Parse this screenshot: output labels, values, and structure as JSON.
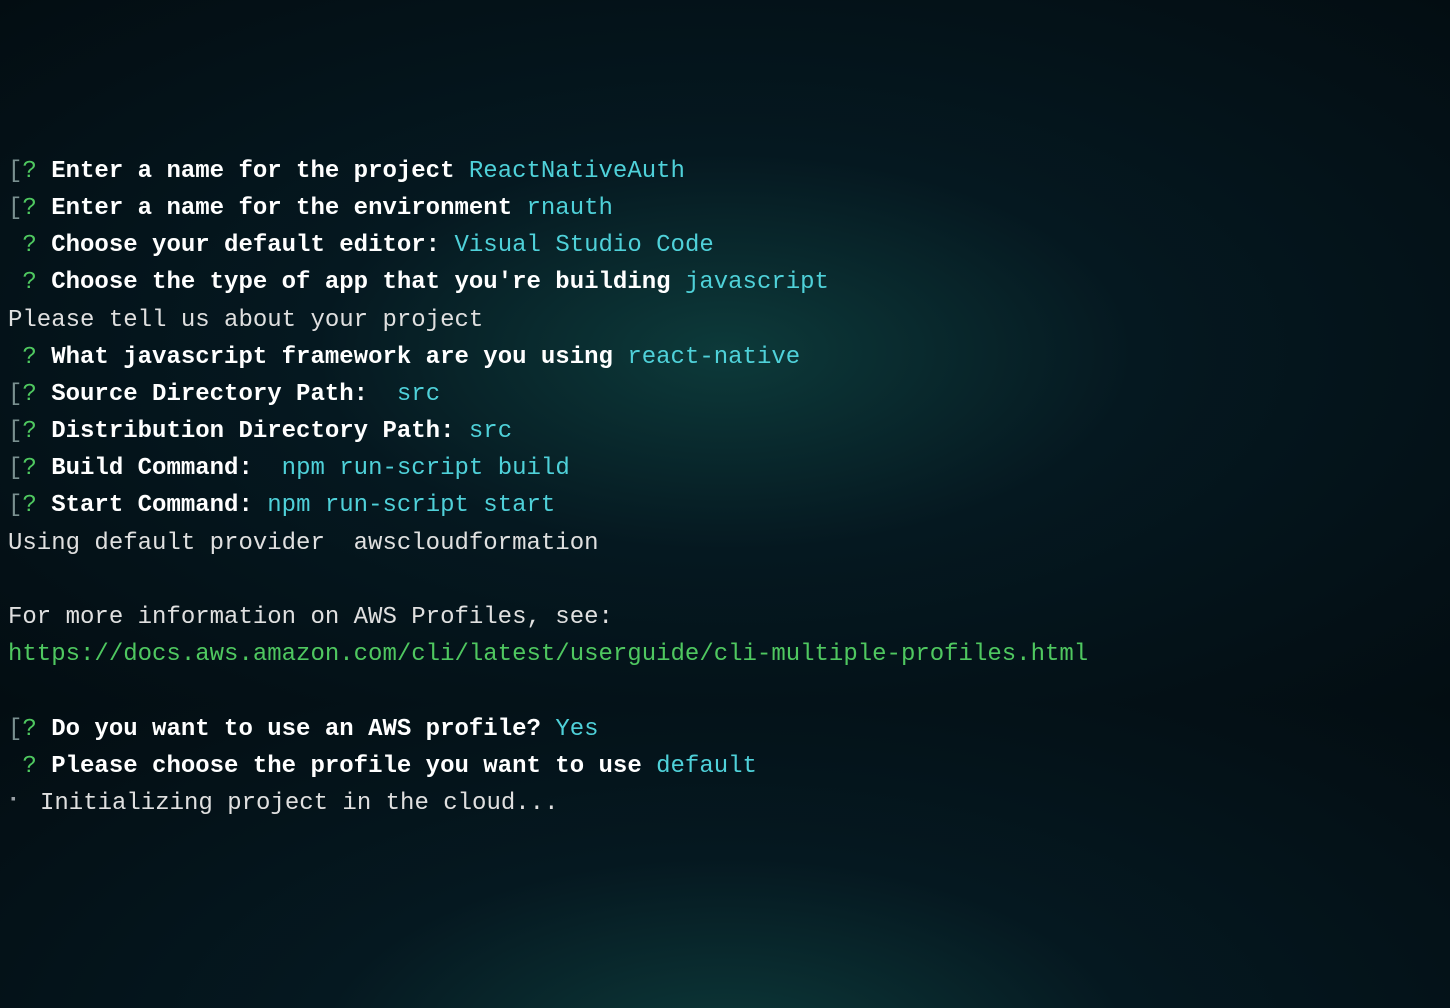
{
  "lines": [
    {
      "prefix": "[",
      "qmark": "?",
      "prompt": "Enter a name for the project",
      "answer": "ReactNativeAuth"
    },
    {
      "prefix": "[",
      "qmark": "?",
      "prompt": "Enter a name for the environment",
      "answer": "rnauth"
    },
    {
      "prefix": " ",
      "qmark": "?",
      "prompt": "Choose your default editor:",
      "answer": "Visual Studio Code"
    },
    {
      "prefix": " ",
      "qmark": "?",
      "prompt": "Choose the type of app that you're building",
      "answer": "javascript"
    },
    {
      "plain": "Please tell us about your project"
    },
    {
      "prefix": " ",
      "qmark": "?",
      "prompt": "What javascript framework are you using",
      "answer": "react-native"
    },
    {
      "prefix": "[",
      "qmark": "?",
      "prompt": "Source Directory Path: ",
      "answer": "src"
    },
    {
      "prefix": "[",
      "qmark": "?",
      "prompt": "Distribution Directory Path:",
      "answer": "src"
    },
    {
      "prefix": "[",
      "qmark": "?",
      "prompt": "Build Command: ",
      "answer": "npm run-script build"
    },
    {
      "prefix": "[",
      "qmark": "?",
      "prompt": "Start Command:",
      "answer": "npm run-script start"
    },
    {
      "plain": "Using default provider  awscloudformation"
    },
    {
      "blank": true
    },
    {
      "plain": "For more information on AWS Profiles, see:"
    },
    {
      "url": "https://docs.aws.amazon.com/cli/latest/userguide/cli-multiple-profiles.html"
    },
    {
      "blank": true
    },
    {
      "prefix": "[",
      "qmark": "?",
      "prompt": "Do you want to use an AWS profile?",
      "answer": "Yes"
    },
    {
      "prefix": " ",
      "qmark": "?",
      "prompt": "Please choose the profile you want to use",
      "answer": "default"
    },
    {
      "spinner": "⠂",
      "status": " Initializing project in the cloud..."
    }
  ]
}
